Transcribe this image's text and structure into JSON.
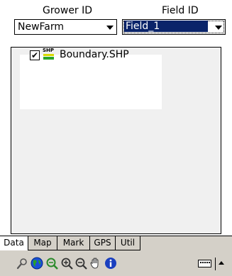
{
  "header": {
    "grower_label": "Grower ID",
    "field_label": "Field ID",
    "grower_value": "NewFarm",
    "field_value": "Field_1"
  },
  "layers": [
    {
      "label": "Boundary.SHP",
      "checked": true,
      "icon_text": "SHP"
    }
  ],
  "tabs": [
    {
      "label": "Data",
      "active": true
    },
    {
      "label": "Map"
    },
    {
      "label": "Mark"
    },
    {
      "label": "GPS"
    },
    {
      "label": "Util"
    }
  ],
  "toolbar": {
    "tools": [
      "select-tool-icon",
      "globe-icon",
      "zoom-extent-icon",
      "zoom-in-icon",
      "zoom-out-icon",
      "pan-hand-icon",
      "info-icon"
    ]
  },
  "colors": {
    "selection": "#0a246a",
    "chrome": "#d4d0c8",
    "panel": "#f0f0f0"
  }
}
